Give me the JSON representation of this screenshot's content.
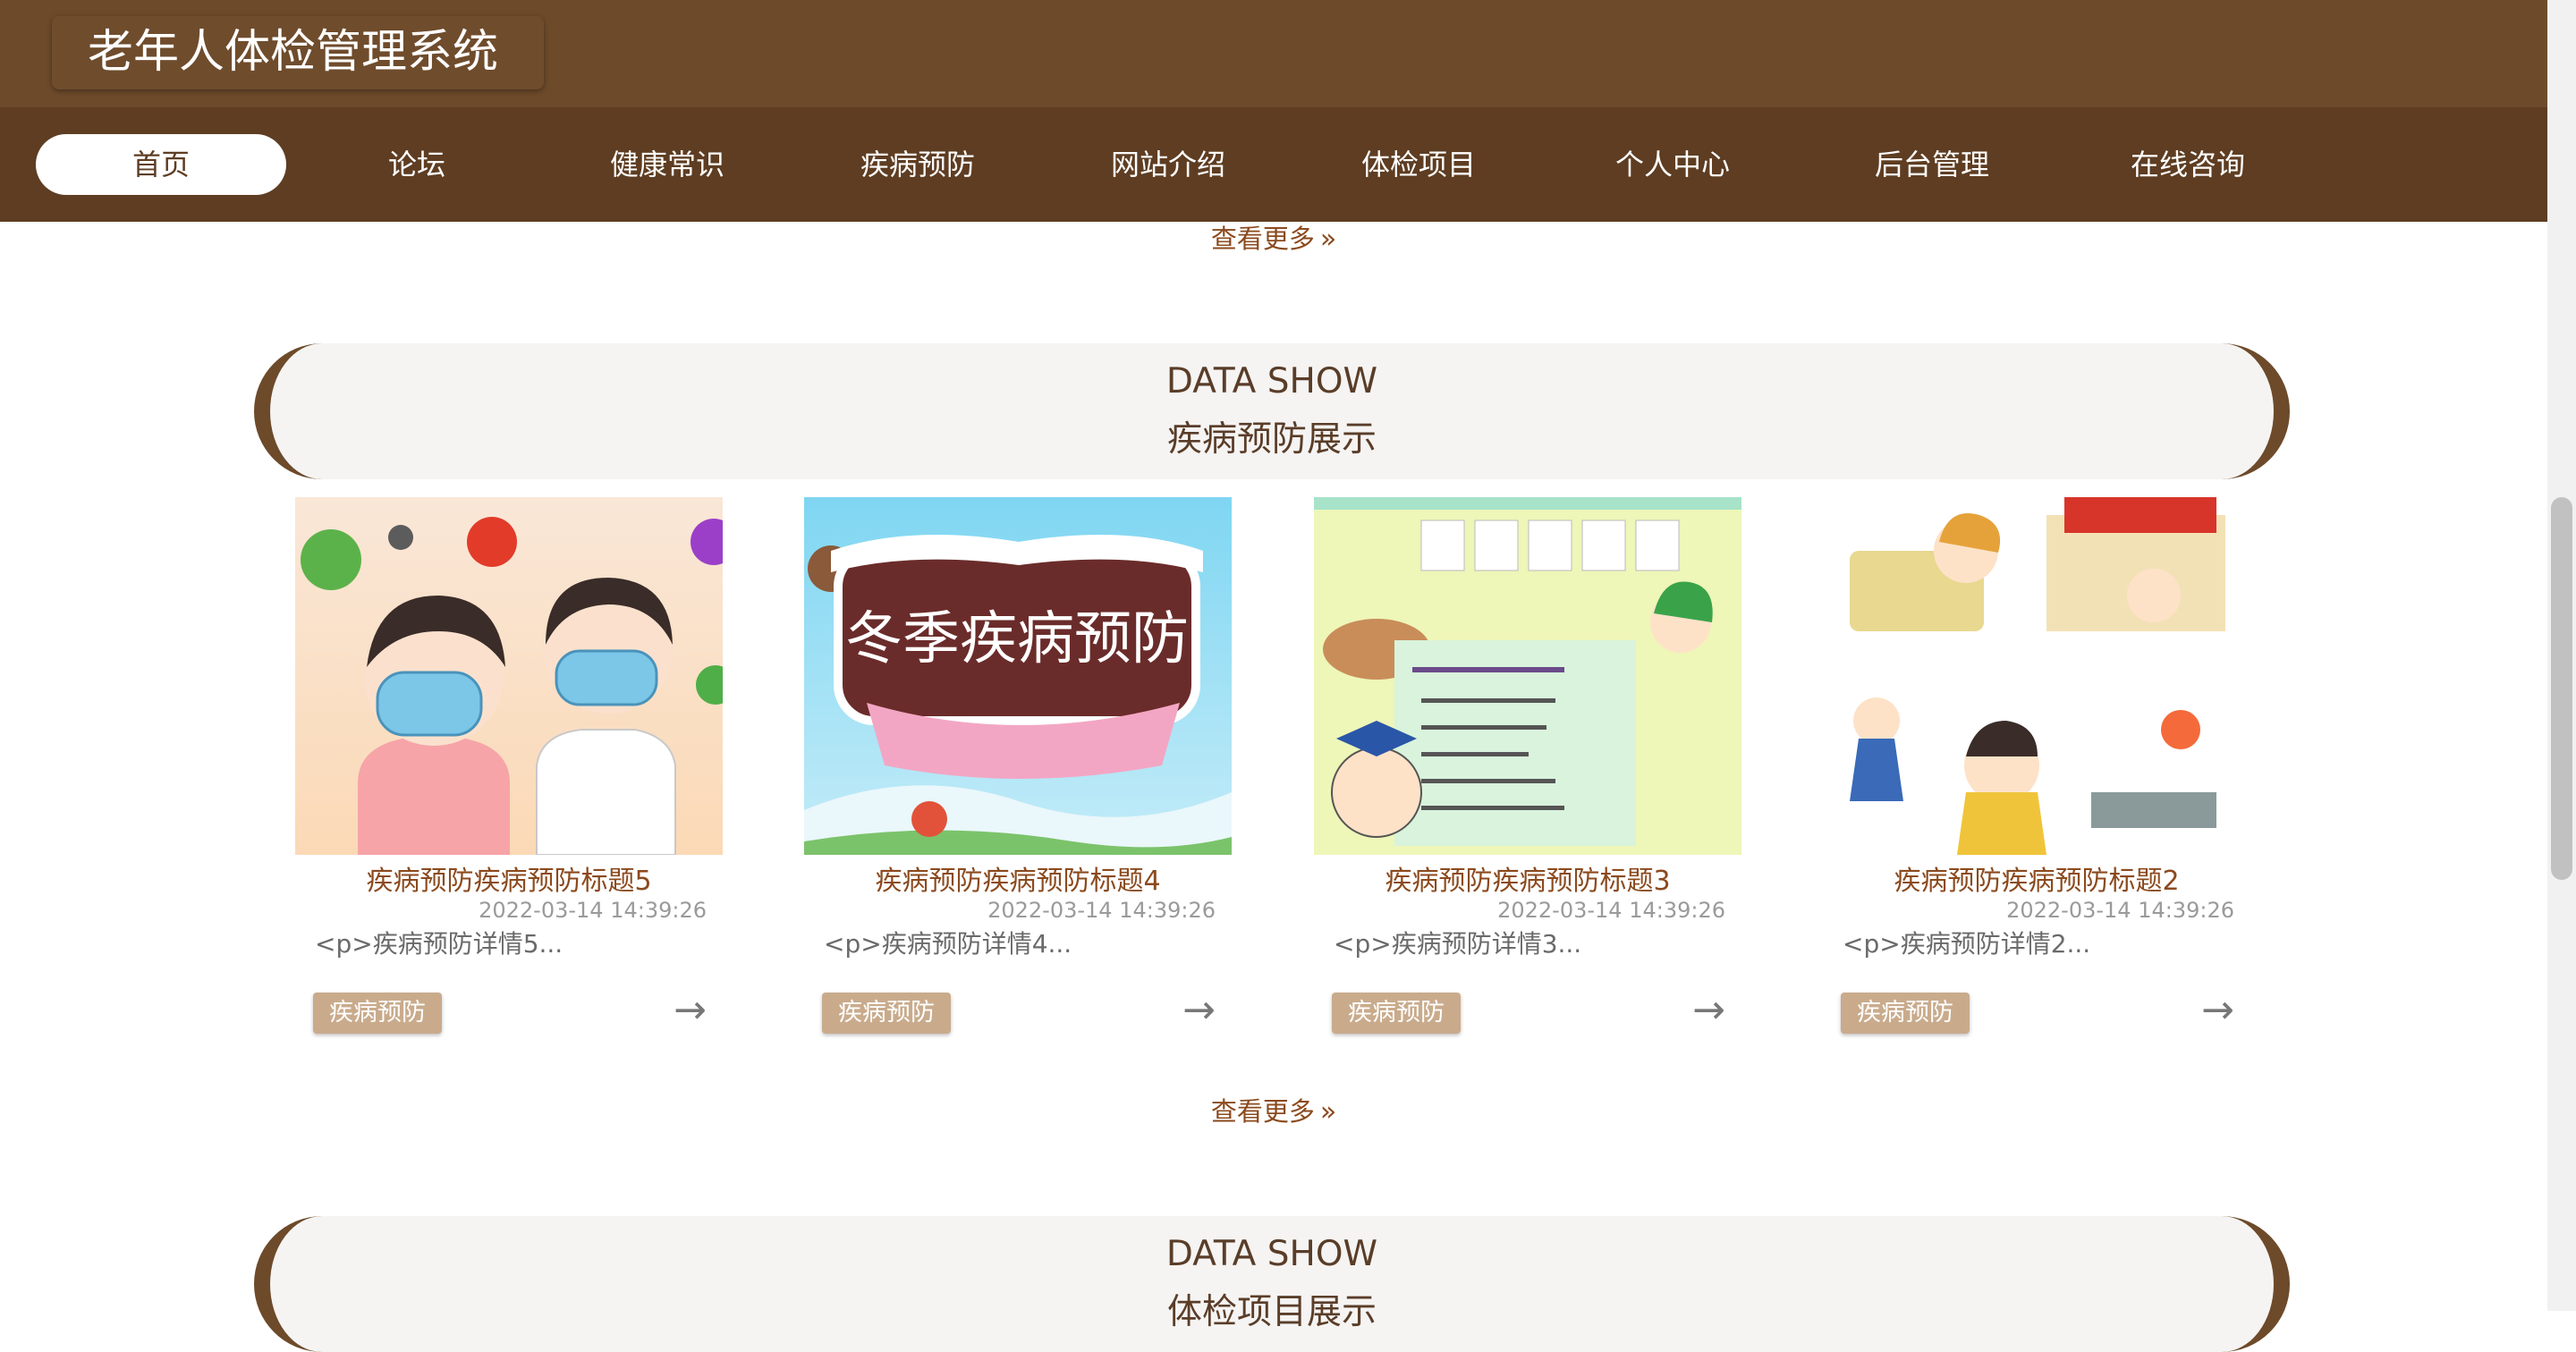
{
  "app": {
    "title": "老年人体检管理系统"
  },
  "nav": {
    "items": [
      {
        "label": "首页",
        "active": true
      },
      {
        "label": "论坛"
      },
      {
        "label": "健康常识"
      },
      {
        "label": "疾病预防"
      },
      {
        "label": "网站介绍"
      },
      {
        "label": "体检项目"
      },
      {
        "label": "个人中心"
      },
      {
        "label": "后台管理"
      },
      {
        "label": "在线咨询"
      }
    ]
  },
  "more_label": "查看更多",
  "sections": [
    {
      "en": "DATA SHOW",
      "cn": "疾病预防展示",
      "cards": [
        {
          "title": "疾病预防疾病预防标题5",
          "date": "2022-03-14 14:39:26",
          "desc": "<p>疾病预防详情5...",
          "tag": "疾病预防",
          "image": "children-with-masks-illustration"
        },
        {
          "title": "疾病预防疾病预防标题4",
          "date": "2022-03-14 14:39:26",
          "desc": "<p>疾病预防详情4...",
          "tag": "疾病预防",
          "image": "winter-disease-prevention-banner",
          "image_text": "冬季疾病预防"
        },
        {
          "title": "疾病预防疾病预防标题3",
          "date": "2022-03-14 14:39:26",
          "desc": "<p>疾病预防详情3...",
          "tag": "疾病预防",
          "image": "intestinal-disease-prevention-poster"
        },
        {
          "title": "疾病预防疾病预防标题2",
          "date": "2022-03-14 14:39:26",
          "desc": "<p>疾病预防详情2...",
          "tag": "疾病预防",
          "image": "hygiene-habits-cartoon"
        }
      ]
    },
    {
      "en": "DATA SHOW",
      "cn": "体检项目展示"
    }
  ],
  "icons": {
    "more": "double-chevron-right-icon",
    "card_arrow": "arrow-right-icon"
  },
  "colors": {
    "header": "#6d4a2a",
    "nav": "#5e3d22",
    "accent": "#8b4a1e",
    "tag": "#c9ab8c"
  }
}
